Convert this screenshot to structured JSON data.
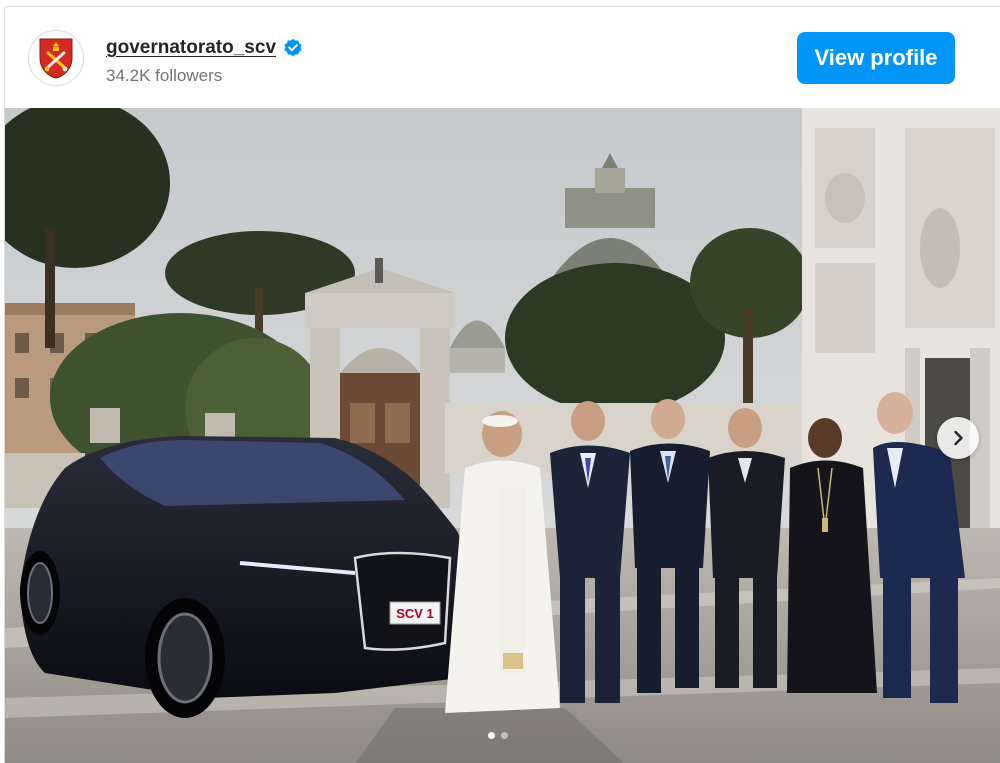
{
  "post": {
    "username": "governatorato_scv",
    "followers": "34.2K followers",
    "verified": true,
    "view_profile_label": "View profile",
    "avatar_icon": "vatican-coat-of-arms-icon",
    "verified_icon": "verified-badge-icon",
    "next_icon": "chevron-right-icon",
    "accent_color": "#0095f6",
    "carousel": {
      "total": 2,
      "current": 1
    },
    "photo": {
      "plate_text": "SCV 1"
    }
  }
}
